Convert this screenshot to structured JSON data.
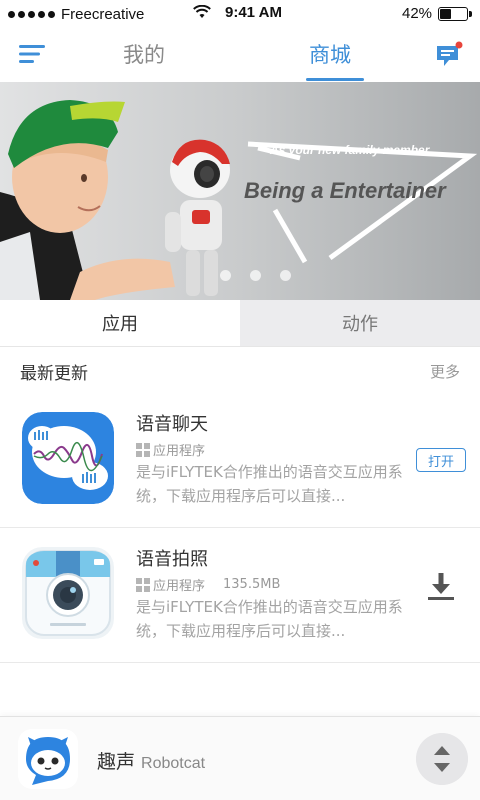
{
  "status_bar": {
    "carrier": "Freecreative",
    "time": "9:41 AM",
    "battery_percent": "42%",
    "battery_level": 0.42
  },
  "nav": {
    "tabs": [
      {
        "label": "我的",
        "active": false
      },
      {
        "label": "商城",
        "active": true
      }
    ],
    "accent_color": "#3f8fd8",
    "icons": [
      "menu-icon",
      "message-icon"
    ]
  },
  "banner": {
    "subtitle": "As your new family member.",
    "title": "Being a Entertainer",
    "slide_count": 3
  },
  "segment_tabs": [
    {
      "label": "应用",
      "active": true
    },
    {
      "label": "动作",
      "active": false
    }
  ],
  "section": {
    "title": "最新更新",
    "more_label": "更多"
  },
  "apps": [
    {
      "name": "语音聊天",
      "type": "应用程序",
      "size": "",
      "description": "是与iFLYTEK合作推出的语音交互应用系统，下载应用程序后可以直接...",
      "action": "打开"
    },
    {
      "name": "语音拍照",
      "type": "应用程序",
      "size": "135.5MB",
      "description": "是与iFLYTEK合作推出的语音交互应用系统，下载应用程序后可以直接...",
      "action": "download-icon"
    }
  ],
  "bottom_bar": {
    "name": "趣声",
    "subtitle": "Robotcat"
  }
}
